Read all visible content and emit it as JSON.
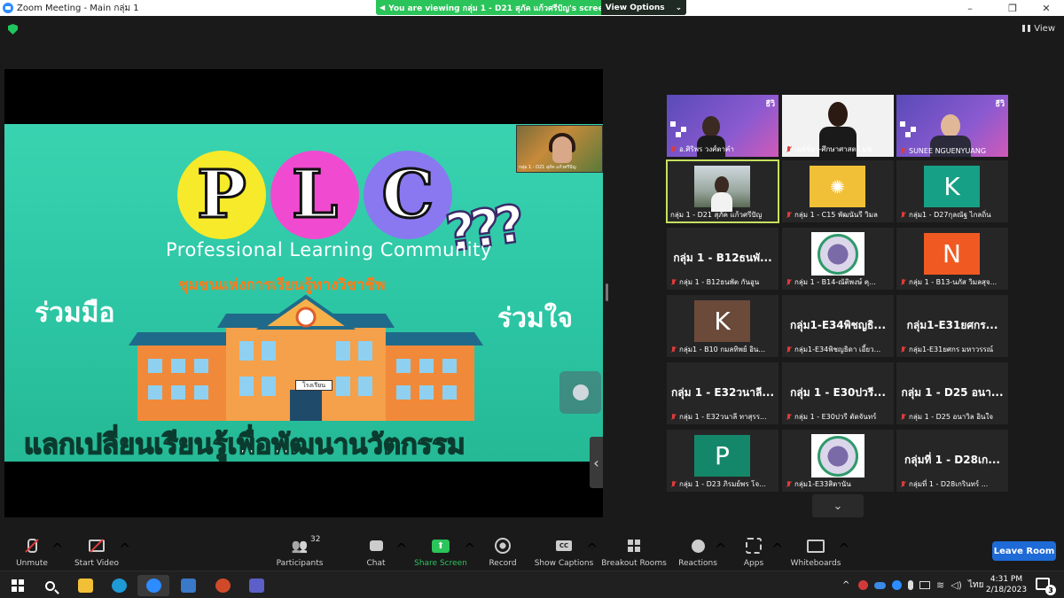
{
  "window": {
    "title": "Zoom Meeting - Main กลุ่ม 1",
    "minimize": "–",
    "maximize": "❐",
    "close": "✕"
  },
  "banner": {
    "text": "You are viewing กลุ่ม 1 - D21 สุภัค แก้วศรีปัญ's screen",
    "options_label": "View Options",
    "options_caret": "⌄"
  },
  "view_button": {
    "label": "View"
  },
  "slide": {
    "letters": [
      "P",
      "L",
      "C"
    ],
    "question_marks": "???",
    "subtitle_en": "Professional Learning Community",
    "subtitle_th": "ชุมชนแห่งการเรียนรู้ทางวิชาชีพ",
    "left_text": "ร่วมมือ",
    "right_text": "ร่วมใจ",
    "bottom_text": "แลกเปลี่ยนเรียนรู้เพื่อพัฒนานวัตกรรม",
    "school_sign": "โรงเรียน",
    "thumbnail_caption": "กลุ่ม 1 - D21 สุภัค แก้วศรีปัญ"
  },
  "gallery": {
    "tiles": [
      {
        "type": "video",
        "label": "อ.ศิริพร วงศ์ตาคำ",
        "muted": true,
        "brand": "ธีวิ"
      },
      {
        "type": "video",
        "label": "เนย์ชิยา-ศึกษาศาสตร์ มช.",
        "muted": true
      },
      {
        "type": "video",
        "label": "SUNEE NGUENYUANG",
        "muted": true,
        "brand": "ธีวิ"
      },
      {
        "type": "video",
        "label": "กลุ่ม 1 - D21 สุภัค แก้วศรีปัญ",
        "muted": false,
        "active": true
      },
      {
        "type": "image",
        "label": "กลุ่ม 1 - C15 พัฒนันรี วิมล",
        "muted": true
      },
      {
        "type": "avatar",
        "letter": "K",
        "color": "#16a085",
        "label": "กลุ่ม1 - D27กุลณัฐ ไกลถิ่น",
        "muted": true
      },
      {
        "type": "name",
        "bigname": "กลุ่ม 1 - B12ธนพั...",
        "label": "กลุ่ม 1 - B12ธนพัต กันอูน",
        "muted": true
      },
      {
        "type": "seal",
        "label": "กลุ่ม 1 - B14-ณัติพงษ์ คุ...",
        "muted": true
      },
      {
        "type": "avatar",
        "letter": "N",
        "color": "#f05a22",
        "label": "กลุ่ม 1 - B13-นภัส วิมลสุจ...",
        "muted": true
      },
      {
        "type": "avatar",
        "letter": "K",
        "color": "#6b4a3a",
        "label": "กลุ่ม1 - B10 กมลทิพย์ อิน...",
        "muted": true
      },
      {
        "type": "name",
        "bigname": "กลุ่ม1-E34พิชญธิ...",
        "label": "กลุ่ม1-E34พิชญธิดา เอี้ยว...",
        "muted": true
      },
      {
        "type": "name",
        "bigname": "กลุ่ม1-E31ยศกร...",
        "label": "กลุ่ม1-E31ยศกร มหาวรรณ์",
        "muted": true
      },
      {
        "type": "name",
        "bigname": "กลุ่ม 1 - E32วนาลี...",
        "label": "กลุ่ม 1 - E32วนาลี ทาสุรร...",
        "muted": true
      },
      {
        "type": "name",
        "bigname": "กลุ่ม 1 - E30ปวรี...",
        "label": "กลุ่ม 1 - E30ปวรี ตัดจันทร์",
        "muted": true
      },
      {
        "type": "name",
        "bigname": "กลุ่ม 1 - D25 อนา...",
        "label": "กลุ่ม 1 - D25 อนาวิล อินใจ",
        "muted": true
      },
      {
        "type": "avatar",
        "letter": "P",
        "color": "#14876a",
        "label": "กลุ่ม 1 - D23 ภิรมย์พร โจ...",
        "muted": true
      },
      {
        "type": "seal",
        "label": "กลุ่ม1-E33สิตานัน",
        "muted": true
      },
      {
        "type": "name",
        "bigname": "กลุ่มที่ 1 - D28เก...",
        "label": "กลุ่มที่ 1 - D28เกรินทร์ ...",
        "muted": true
      }
    ],
    "scroll_down": "⌄"
  },
  "toolbar": {
    "unmute": "Unmute",
    "start_video": "Start Video",
    "participants": "Participants",
    "participants_count": "32",
    "chat": "Chat",
    "share_screen": "Share Screen",
    "record": "Record",
    "show_captions": "Show Captions",
    "breakout_rooms": "Breakout Rooms",
    "reactions": "Reactions",
    "apps": "Apps",
    "whiteboards": "Whiteboards",
    "leave": "Leave Room",
    "caret": "^"
  },
  "taskbar": {
    "language": "ไทย",
    "time": "4:31 PM",
    "date": "2/18/2023",
    "notification_count": "3",
    "tray_up": "^"
  },
  "colors": {
    "share_green": "#2bc45a",
    "leave_blue": "#1e6ad6",
    "active_outline": "#c6e05e",
    "slide_bg": "#2dc7a6"
  }
}
